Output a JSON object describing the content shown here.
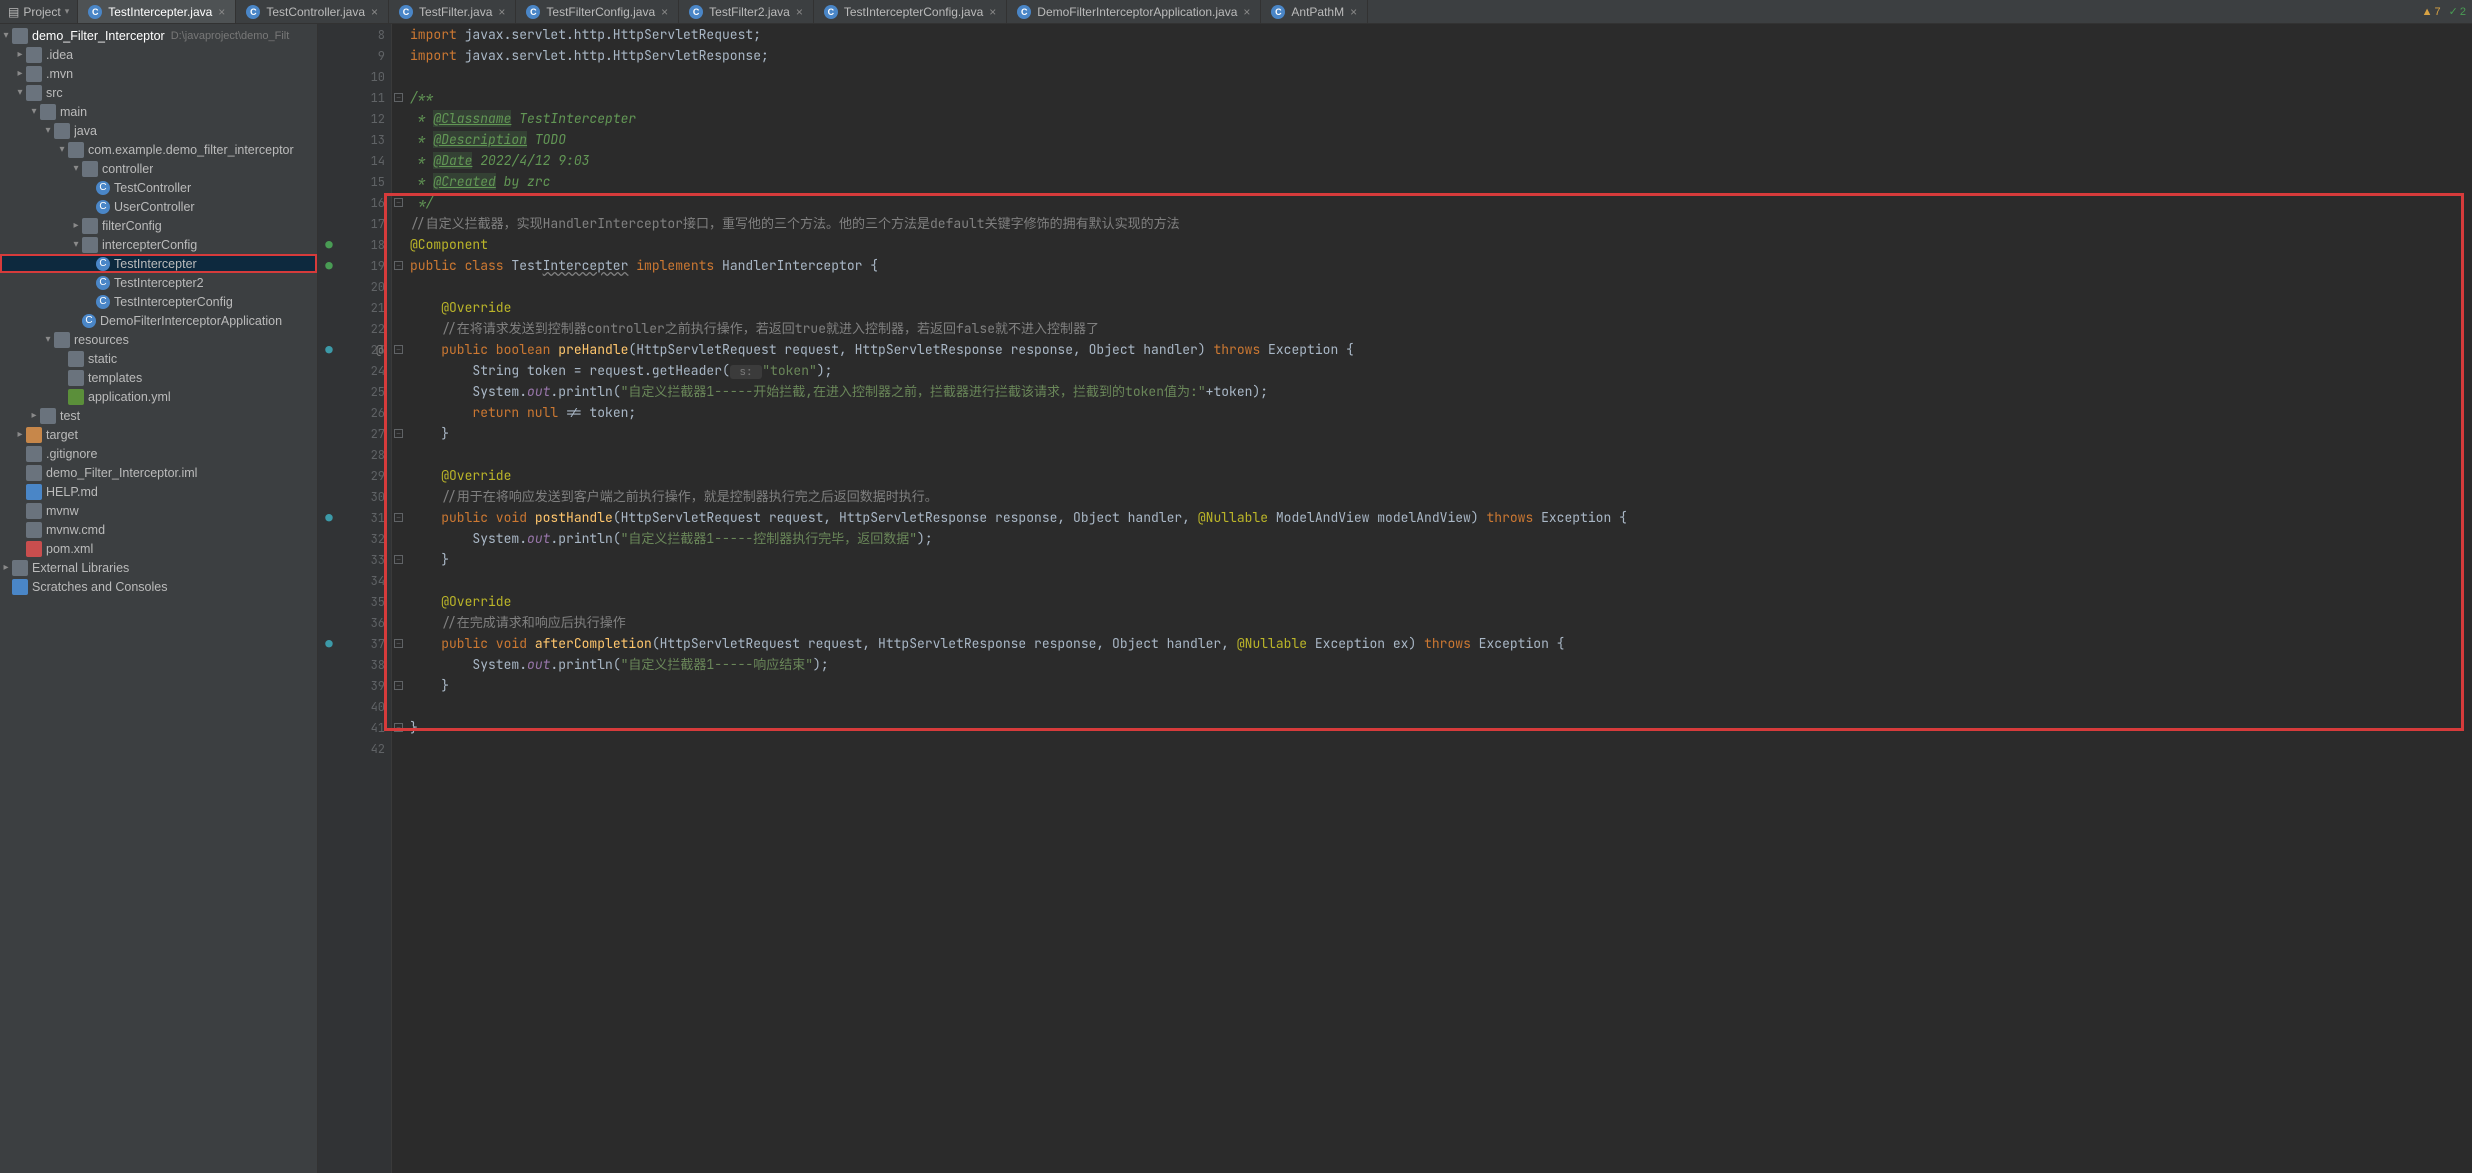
{
  "projectToolLabel": "Project",
  "tabs": [
    {
      "name": "TestIntercepter.java",
      "active": true
    },
    {
      "name": "TestController.java",
      "active": false
    },
    {
      "name": "TestFilter.java",
      "active": false
    },
    {
      "name": "TestFilterConfig.java",
      "active": false
    },
    {
      "name": "TestFilter2.java",
      "active": false
    },
    {
      "name": "TestIntercepterConfig.java",
      "active": false
    },
    {
      "name": "DemoFilterInterceptorApplication.java",
      "active": false
    },
    {
      "name": "AntPathM",
      "active": false
    }
  ],
  "indicators": {
    "warn": "7",
    "ok": "2"
  },
  "tree": {
    "root": {
      "name": "demo_Filter_Interceptor",
      "hint": "D:\\javaproject\\demo_Filt"
    },
    "items": [
      {
        "d": 1,
        "arrow": ">",
        "icon": "folder",
        "label": ".idea"
      },
      {
        "d": 1,
        "arrow": ">",
        "icon": "folder",
        "label": ".mvn"
      },
      {
        "d": 1,
        "arrow": "v",
        "icon": "folder",
        "label": "src"
      },
      {
        "d": 2,
        "arrow": "v",
        "icon": "folder",
        "label": "main"
      },
      {
        "d": 3,
        "arrow": "v",
        "icon": "folder",
        "label": "java"
      },
      {
        "d": 4,
        "arrow": "v",
        "icon": "pkg",
        "label": "com.example.demo_filter_interceptor"
      },
      {
        "d": 5,
        "arrow": "v",
        "icon": "pkg",
        "label": "controller"
      },
      {
        "d": 6,
        "arrow": "",
        "icon": "class",
        "label": "TestController"
      },
      {
        "d": 6,
        "arrow": "",
        "icon": "class",
        "label": "UserController"
      },
      {
        "d": 5,
        "arrow": ">",
        "icon": "pkg",
        "label": "filterConfig"
      },
      {
        "d": 5,
        "arrow": "v",
        "icon": "pkg",
        "label": "intercepterConfig"
      },
      {
        "d": 6,
        "arrow": "",
        "icon": "class",
        "label": "TestIntercepter",
        "selected": true
      },
      {
        "d": 6,
        "arrow": "",
        "icon": "class",
        "label": "TestIntercepter2"
      },
      {
        "d": 6,
        "arrow": "",
        "icon": "class",
        "label": "TestIntercepterConfig"
      },
      {
        "d": 5,
        "arrow": "",
        "icon": "class",
        "label": "DemoFilterInterceptorApplication"
      },
      {
        "d": 3,
        "arrow": "v",
        "icon": "folder",
        "label": "resources"
      },
      {
        "d": 4,
        "arrow": "",
        "icon": "folder",
        "label": "static"
      },
      {
        "d": 4,
        "arrow": "",
        "icon": "folder",
        "label": "templates"
      },
      {
        "d": 4,
        "arrow": "",
        "icon": "yml",
        "label": "application.yml"
      },
      {
        "d": 2,
        "arrow": ">",
        "icon": "folder",
        "label": "test"
      },
      {
        "d": 1,
        "arrow": ">",
        "icon": "folder-orange",
        "label": "target"
      },
      {
        "d": 1,
        "arrow": "",
        "icon": "file",
        "label": ".gitignore"
      },
      {
        "d": 1,
        "arrow": "",
        "icon": "file",
        "label": "demo_Filter_Interceptor.iml"
      },
      {
        "d": 1,
        "arrow": "",
        "icon": "md",
        "label": "HELP.md"
      },
      {
        "d": 1,
        "arrow": "",
        "icon": "file",
        "label": "mvnw"
      },
      {
        "d": 1,
        "arrow": "",
        "icon": "file",
        "label": "mvnw.cmd"
      },
      {
        "d": 1,
        "arrow": "",
        "icon": "m",
        "label": "pom.xml"
      }
    ],
    "extLib": "External Libraries",
    "scratch": "Scratches and Consoles"
  },
  "gutter": {
    "start": 8,
    "end": 42,
    "marks": {
      "18": "green",
      "19": "green",
      "23": "cyan",
      "31": "cyan",
      "37": "cyan"
    },
    "at": {
      "23": "@"
    }
  },
  "code": {
    "l8": {
      "kw1": "import ",
      "p1": "javax.servlet.http.HttpServletRequest;"
    },
    "l9": {
      "kw1": "import ",
      "p1": "javax.servlet.http.HttpServletResponse;"
    },
    "l11": {
      "d": "/**"
    },
    "l12": {
      "s": " * ",
      "tag": "@Classname",
      "rest": " TestIntercepter"
    },
    "l13": {
      "s": " * ",
      "tag": "@Description",
      "rest": " TODO"
    },
    "l14": {
      "s": " * ",
      "tag": "@Date",
      "rest": " 2022/4/12 9:03"
    },
    "l15": {
      "s": " * ",
      "tag": "@Created",
      "rest": " by zrc"
    },
    "l16": {
      "d": " */"
    },
    "l17": {
      "c": "//自定义拦截器，实现HandlerInterceptor接口，重写他的三个方法。他的三个方法是default关键字修饰的拥有默认实现的方法"
    },
    "l18": {
      "ann": "@Component"
    },
    "l19": {
      "kw1": "public class ",
      "name": "TestIntercepter",
      "kw2": " implements ",
      "iface": "HandlerInterceptor {"
    },
    "l21": {
      "ann": "    @Override"
    },
    "l22": {
      "c": "    //在将请求发送到控制器controller之前执行操作，若返回true就进入控制器，若返回false就不进入控制器了"
    },
    "l23": {
      "pre": "    ",
      "kw1": "public boolean ",
      "fn": "preHandle",
      "sig1": "(HttpServletRequest request, HttpServletResponse response, Object handler) ",
      "kw2": "throws ",
      "exc": "Exception {"
    },
    "l24": {
      "pre": "        ",
      "txt1": "String token = request.getHeader(",
      "hint": " s: ",
      "str": "\"token\"",
      "txt2": ");"
    },
    "l25": {
      "pre": "        ",
      "txt1": "System.",
      "fld": "out",
      ".p": ".println(",
      "str": "\"自定义拦截器1-----开始拦截,在进入控制器之前，拦截器进行拦截该请求，拦截到的token值为:\"",
      "tail": "+token);"
    },
    "l26": {
      "pre": "        ",
      "kw": "return null ",
      "txt": "!= token;"
    },
    "l27": {
      "b": "    }"
    },
    "l29": {
      "ann": "    @Override"
    },
    "l30": {
      "c": "    //用于在将响应发送到客户端之前执行操作，就是控制器执行完之后返回数据时执行。"
    },
    "l31": {
      "pre": "    ",
      "kw1": "public void ",
      "fn": "postHandle",
      "sig1": "(HttpServletRequest request, HttpServletResponse response, Object handler, ",
      "ann": "@Nullable ",
      "sig2": "ModelAndView modelAndView) ",
      "kw2": "throws ",
      "exc": "Exception {"
    },
    "l32": {
      "pre": "        ",
      "txt1": "System.",
      "fld": "out",
      ".p": ".println(",
      "str": "\"自定义拦截器1-----控制器执行完毕，返回数据\"",
      "tail": ");"
    },
    "l33": {
      "b": "    }"
    },
    "l35": {
      "ann": "    @Override"
    },
    "l36": {
      "c": "    //在完成请求和响应后执行操作"
    },
    "l37": {
      "pre": "    ",
      "kw1": "public void ",
      "fn": "afterCompletion",
      "sig1": "(HttpServletRequest request, HttpServletResponse response, Object handler, ",
      "ann": "@Nullable ",
      "sig2": "Exception ex) ",
      "kw2": "throws ",
      "exc": "Exception {"
    },
    "l38": {
      "pre": "        ",
      "txt1": "System.",
      "fld": "out",
      ".p": ".println(",
      "str": "\"自定义拦截器1-----响应结束\"",
      "tail": ");"
    },
    "l39": {
      "b": "    }"
    },
    "l41": {
      "b": "}"
    }
  }
}
